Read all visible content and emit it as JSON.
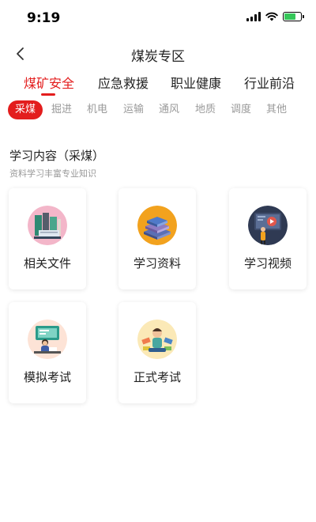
{
  "status_bar": {
    "time": "9:19",
    "icons": [
      "signal-icon",
      "wifi-icon",
      "battery-charging-icon"
    ]
  },
  "header": {
    "back_icon": "chevron-left-icon",
    "title": "煤炭专区"
  },
  "main_tabs": [
    {
      "label": "煤矿安全",
      "active": true
    },
    {
      "label": "应急救援",
      "active": false
    },
    {
      "label": "职业健康",
      "active": false
    },
    {
      "label": "行业前沿",
      "active": false
    }
  ],
  "sub_tabs": [
    {
      "label": "采煤",
      "active": true
    },
    {
      "label": "掘进",
      "active": false
    },
    {
      "label": "机电",
      "active": false
    },
    {
      "label": "运输",
      "active": false
    },
    {
      "label": "通风",
      "active": false
    },
    {
      "label": "地质",
      "active": false
    },
    {
      "label": "调度",
      "active": false
    },
    {
      "label": "其他",
      "active": false
    }
  ],
  "section": {
    "title": "学习内容（采煤）",
    "subtitle": "资料学习丰富专业知识"
  },
  "cards": [
    {
      "label": "相关文件",
      "icon": "documents-icon"
    },
    {
      "label": "学习资料",
      "icon": "books-stack-icon"
    },
    {
      "label": "学习视频",
      "icon": "video-lesson-icon"
    },
    {
      "label": "模拟考试",
      "icon": "mock-exam-icon"
    },
    {
      "label": "正式考试",
      "icon": "formal-exam-icon"
    }
  ],
  "colors": {
    "accent": "#e31d1d",
    "muted_text": "#9a9a9a",
    "battery_green": "#35c759"
  }
}
